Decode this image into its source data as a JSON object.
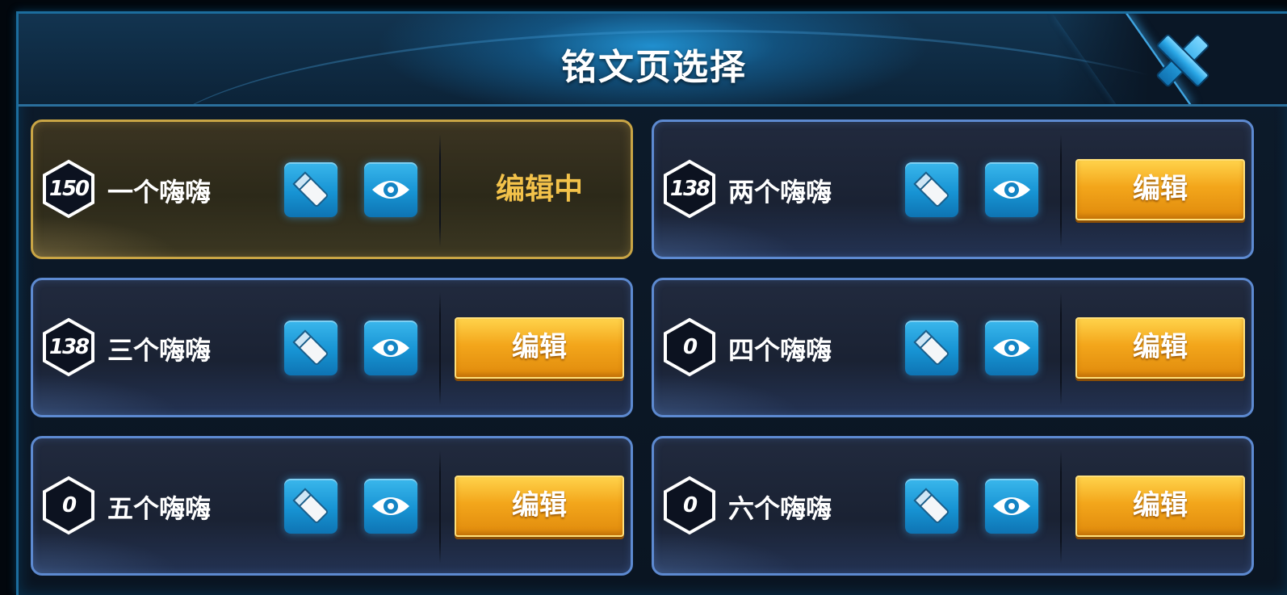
{
  "dialog": {
    "title": "铭文页选择",
    "close_icon": "close-x-icon"
  },
  "pages": [
    {
      "level": "150",
      "name": "一个嗨嗨",
      "state": "editing",
      "action_label": "编辑中"
    },
    {
      "level": "138",
      "name": "两个嗨嗨",
      "state": "idle",
      "action_label": "编辑"
    },
    {
      "level": "138",
      "name": "三个嗨嗨",
      "state": "idle",
      "action_label": "编辑"
    },
    {
      "level": "0",
      "name": "四个嗨嗨",
      "state": "idle",
      "action_label": "编辑"
    },
    {
      "level": "0",
      "name": "五个嗨嗨",
      "state": "idle",
      "action_label": "编辑"
    },
    {
      "level": "0",
      "name": "六个嗨嗨",
      "state": "idle",
      "action_label": "编辑"
    }
  ],
  "icons": {
    "rename": "pencil-eraser-icon",
    "preview": "eye-icon"
  },
  "colors": {
    "accent_blue": "#1793d3",
    "button_orange": "#f3a61b",
    "active_gold": "#c9a545",
    "editing_text": "#f3c24a"
  }
}
